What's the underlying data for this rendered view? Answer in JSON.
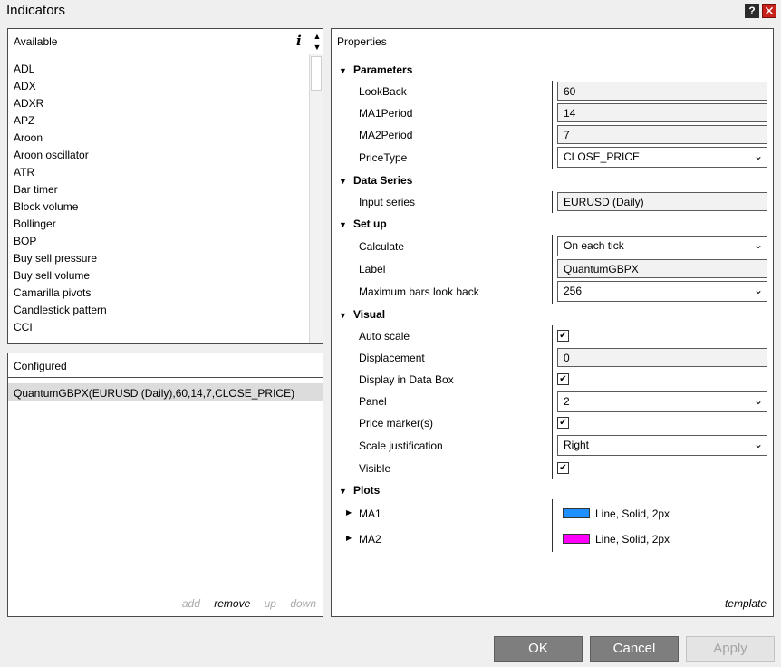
{
  "window": {
    "title": "Indicators",
    "help_label": "?",
    "close_label": "✕"
  },
  "available": {
    "header": "Available",
    "info_label": "i",
    "items": [
      "ADL",
      "ADX",
      "ADXR",
      "APZ",
      "Aroon",
      "Aroon oscillator",
      "ATR",
      "Bar timer",
      "Block volume",
      "Bollinger",
      "BOP",
      "Buy sell pressure",
      "Buy sell volume",
      "Camarilla pivots",
      "Candlestick pattern",
      "CCI"
    ]
  },
  "configured": {
    "header": "Configured",
    "items": [
      "QuantumGBPX(EURUSD (Daily),60,14,7,CLOSE_PRICE)"
    ],
    "actions": {
      "add": "add",
      "remove": "remove",
      "up": "up",
      "down": "down"
    }
  },
  "properties": {
    "header": "Properties",
    "categories": {
      "parameters": "Parameters",
      "data_series": "Data Series",
      "set_up": "Set up",
      "visual": "Visual",
      "plots": "Plots"
    },
    "params": {
      "lookback": {
        "label": "LookBack",
        "value": "60"
      },
      "ma1period": {
        "label": "MA1Period",
        "value": "14"
      },
      "ma2period": {
        "label": "MA2Period",
        "value": "7"
      },
      "pricetype": {
        "label": "PriceType",
        "value": "CLOSE_PRICE"
      }
    },
    "data_series": {
      "input_series": {
        "label": "Input series",
        "value": "EURUSD (Daily)"
      }
    },
    "setup": {
      "calculate": {
        "label": "Calculate",
        "value": "On each tick"
      },
      "label": {
        "label": "Label",
        "value": "QuantumGBPX"
      },
      "max_bars": {
        "label": "Maximum bars look back",
        "value": "256"
      }
    },
    "visual": {
      "auto_scale": {
        "label": "Auto scale",
        "checked": true
      },
      "displacement": {
        "label": "Displacement",
        "value": "0"
      },
      "display_in_data_box": {
        "label": "Display in Data Box",
        "checked": true
      },
      "panel": {
        "label": "Panel",
        "value": "2"
      },
      "price_markers": {
        "label": "Price marker(s)",
        "checked": true
      },
      "scale_justification": {
        "label": "Scale justification",
        "value": "Right"
      },
      "visible": {
        "label": "Visible",
        "checked": true
      }
    },
    "plots": [
      {
        "label": "MA1",
        "color": "#1e90ff",
        "desc": "Line, Solid, 2px"
      },
      {
        "label": "MA2",
        "color": "#ff00ff",
        "desc": "Line, Solid, 2px"
      }
    ],
    "template_label": "template"
  },
  "buttons": {
    "ok": "OK",
    "cancel": "Cancel",
    "apply": "Apply"
  }
}
